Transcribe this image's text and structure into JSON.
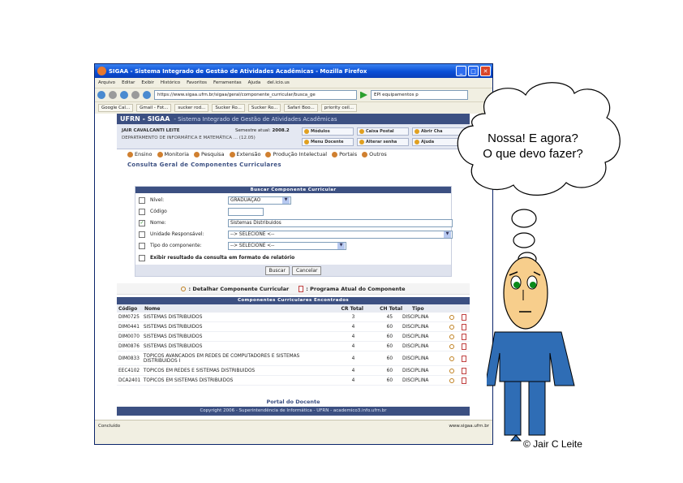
{
  "browser": {
    "title": "SIGAA - Sistema Integrado de Gestão de Atividades Acadêmicas - Mozilla Firefox",
    "menu": [
      "Arquivo",
      "Editar",
      "Exibir",
      "Histórico",
      "Favoritos",
      "Ferramentas",
      "Ajuda",
      "del.icio.us"
    ],
    "url": "https://www.sigaa.ufrn.br/sigaa/geral/componente_curricular/busca_ge",
    "search": "EPI equipamentos p",
    "bookmarks": [
      "Google Cal...",
      "Gmail - Fot...",
      "sucker rod...",
      "Sucker Ro...",
      "Sucker Ro...",
      "Safari Boo...",
      "priority ceil..."
    ],
    "status_left": "Concluído",
    "status_right": "www.sigaa.ufrn.br"
  },
  "sigaa": {
    "brand": "UFRN - SIGAA",
    "brand_sub": "- Sistema Integrado de Gestão de Atividades Acadêmicas",
    "user": "JAIR CAVALCANTI LEITE",
    "dept": "DEPARTAMENTO DE INFORMÁTICA E MATEMÁTICA ... (12.05)",
    "sem_label": "Semestre atual:",
    "sem_value": "2008.2",
    "quick": [
      "Módulos",
      "Caixa Postal",
      "Abrir Cha",
      "Menu Docente",
      "Alterar senha",
      "Ajuda"
    ],
    "modules": [
      "Ensino",
      "Monitoria",
      "Pesquisa",
      "Extensão",
      "Produção Intelectual",
      "Portais",
      "Outros"
    ],
    "page_title": "Consulta Geral de Componentes Curriculares"
  },
  "form": {
    "header": "Buscar Componente Curricular",
    "nivel_label": "Nível:",
    "nivel_value": "GRADUAÇÃO",
    "codigo_label": "Código",
    "codigo_value": "",
    "nome_label": "Nome:",
    "nome_value": "Sistemas Distribuidos",
    "unidade_label": "Unidade Responsável:",
    "unidade_value": "--> SELECIONE <--",
    "tipo_label": "Tipo do componente:",
    "tipo_value": "--> SELECIONE <--",
    "relatorio_label": "Exibir resultado da consulta em formato de relatório",
    "buscar": "Buscar",
    "cancelar": "Cancelar"
  },
  "legend": {
    "detalhar": ": Detalhar Componente Curricular",
    "programa": ": Programa Atual do Componente"
  },
  "results": {
    "header": "Componentes Curriculares Encontrados",
    "columns": [
      "Código",
      "Nome",
      "CR Total",
      "CH Total",
      "Tipo"
    ],
    "rows": [
      [
        "DIM0725",
        "SISTEMAS DISTRIBUIDOS",
        "3",
        "45",
        "DISCIPLINA"
      ],
      [
        "DIM0441",
        "SISTEMAS DISTRIBUIDOS",
        "4",
        "60",
        "DISCIPLINA"
      ],
      [
        "DIM0070",
        "SISTEMAS DISTRIBUIDOS",
        "4",
        "60",
        "DISCIPLINA"
      ],
      [
        "DIM0876",
        "SISTEMAS DISTRIBUIDOS",
        "4",
        "60",
        "DISCIPLINA"
      ],
      [
        "DIM0833",
        "TOPICOS AVANCADOS EM REDES DE COMPUTADORES E SISTEMAS DISTRIBUIDOS I",
        "4",
        "60",
        "DISCIPLINA"
      ],
      [
        "EEC4102",
        "TOPICOS EM REDES E SISTEMAS DISTRIBUIDOS",
        "4",
        "60",
        "DISCIPLINA"
      ],
      [
        "DCA2401",
        "TOPICOS EM SISTEMAS DISTRIBUIDOS",
        "4",
        "60",
        "DISCIPLINA"
      ]
    ]
  },
  "portal": "Portal do Docente",
  "copyright": "Copyright 2006 - Superintendência de Informática - UFRN - academico3.info.ufrn.br",
  "thought": {
    "line1": "Nossa! E agora?",
    "line2": "O que devo fazer?"
  },
  "author": "© Jair C Leite"
}
